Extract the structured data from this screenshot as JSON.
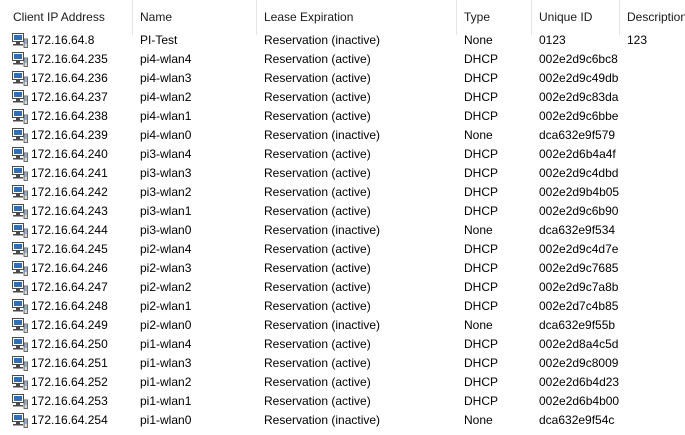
{
  "columns": [
    "Client IP Address",
    "Name",
    "Lease Expiration",
    "Type",
    "Unique ID",
    "Description"
  ],
  "rows": [
    {
      "ip": "172.16.64.8",
      "name": "PI-Test",
      "lease": "Reservation (inactive)",
      "type": "None",
      "uid": "0123",
      "desc": "123"
    },
    {
      "ip": "172.16.64.235",
      "name": "pi4-wlan4",
      "lease": "Reservation (active)",
      "type": "DHCP",
      "uid": "002e2d9c6bc8",
      "desc": ""
    },
    {
      "ip": "172.16.64.236",
      "name": "pi4-wlan3",
      "lease": "Reservation (active)",
      "type": "DHCP",
      "uid": "002e2d9c49db",
      "desc": ""
    },
    {
      "ip": "172.16.64.237",
      "name": "pi4-wlan2",
      "lease": "Reservation (active)",
      "type": "DHCP",
      "uid": "002e2d9c83da",
      "desc": ""
    },
    {
      "ip": "172.16.64.238",
      "name": "pi4-wlan1",
      "lease": "Reservation (active)",
      "type": "DHCP",
      "uid": "002e2d9c6bbe",
      "desc": ""
    },
    {
      "ip": "172.16.64.239",
      "name": "pi4-wlan0",
      "lease": "Reservation (inactive)",
      "type": "None",
      "uid": "dca632e9f579",
      "desc": ""
    },
    {
      "ip": "172.16.64.240",
      "name": "pi3-wlan4",
      "lease": "Reservation (active)",
      "type": "DHCP",
      "uid": "002e2d6b4a4f",
      "desc": ""
    },
    {
      "ip": "172.16.64.241",
      "name": "pi3-wlan3",
      "lease": "Reservation (active)",
      "type": "DHCP",
      "uid": "002e2d9c4dbd",
      "desc": ""
    },
    {
      "ip": "172.16.64.242",
      "name": "pi3-wlan2",
      "lease": "Reservation (active)",
      "type": "DHCP",
      "uid": "002e2d9b4b05",
      "desc": ""
    },
    {
      "ip": "172.16.64.243",
      "name": "pi3-wlan1",
      "lease": "Reservation (active)",
      "type": "DHCP",
      "uid": "002e2d9c6b90",
      "desc": ""
    },
    {
      "ip": "172.16.64.244",
      "name": "pi3-wlan0",
      "lease": "Reservation (inactive)",
      "type": "None",
      "uid": "dca632e9f534",
      "desc": ""
    },
    {
      "ip": "172.16.64.245",
      "name": "pi2-wlan4",
      "lease": "Reservation (active)",
      "type": "DHCP",
      "uid": "002e2d9c4d7e",
      "desc": ""
    },
    {
      "ip": "172.16.64.246",
      "name": "pi2-wlan3",
      "lease": "Reservation (active)",
      "type": "DHCP",
      "uid": "002e2d9c7685",
      "desc": ""
    },
    {
      "ip": "172.16.64.247",
      "name": "pi2-wlan2",
      "lease": "Reservation (active)",
      "type": "DHCP",
      "uid": "002e2d9c7a8b",
      "desc": ""
    },
    {
      "ip": "172.16.64.248",
      "name": "pi2-wlan1",
      "lease": "Reservation (active)",
      "type": "DHCP",
      "uid": "002e2d7c4b85",
      "desc": ""
    },
    {
      "ip": "172.16.64.249",
      "name": "pi2-wlan0",
      "lease": "Reservation (inactive)",
      "type": "None",
      "uid": "dca632e9f55b",
      "desc": ""
    },
    {
      "ip": "172.16.64.250",
      "name": "pi1-wlan4",
      "lease": "Reservation (active)",
      "type": "DHCP",
      "uid": "002e2d8a4c5d",
      "desc": ""
    },
    {
      "ip": "172.16.64.251",
      "name": "pi1-wlan3",
      "lease": "Reservation (active)",
      "type": "DHCP",
      "uid": "002e2d9c8009",
      "desc": ""
    },
    {
      "ip": "172.16.64.252",
      "name": "pi1-wlan2",
      "lease": "Reservation (active)",
      "type": "DHCP",
      "uid": "002e2d6b4d23",
      "desc": ""
    },
    {
      "ip": "172.16.64.253",
      "name": "pi1-wlan1",
      "lease": "Reservation (active)",
      "type": "DHCP",
      "uid": "002e2d6b4b00",
      "desc": ""
    },
    {
      "ip": "172.16.64.254",
      "name": "pi1-wlan0",
      "lease": "Reservation (inactive)",
      "type": "None",
      "uid": "dca632e9f54c",
      "desc": ""
    }
  ],
  "icons": {
    "row_icon": "network-computer-icon"
  },
  "colors": {
    "icon_screen": "#2f6fb8",
    "icon_frame": "#4a4a4a",
    "header_divider": "#e5e5e5"
  }
}
